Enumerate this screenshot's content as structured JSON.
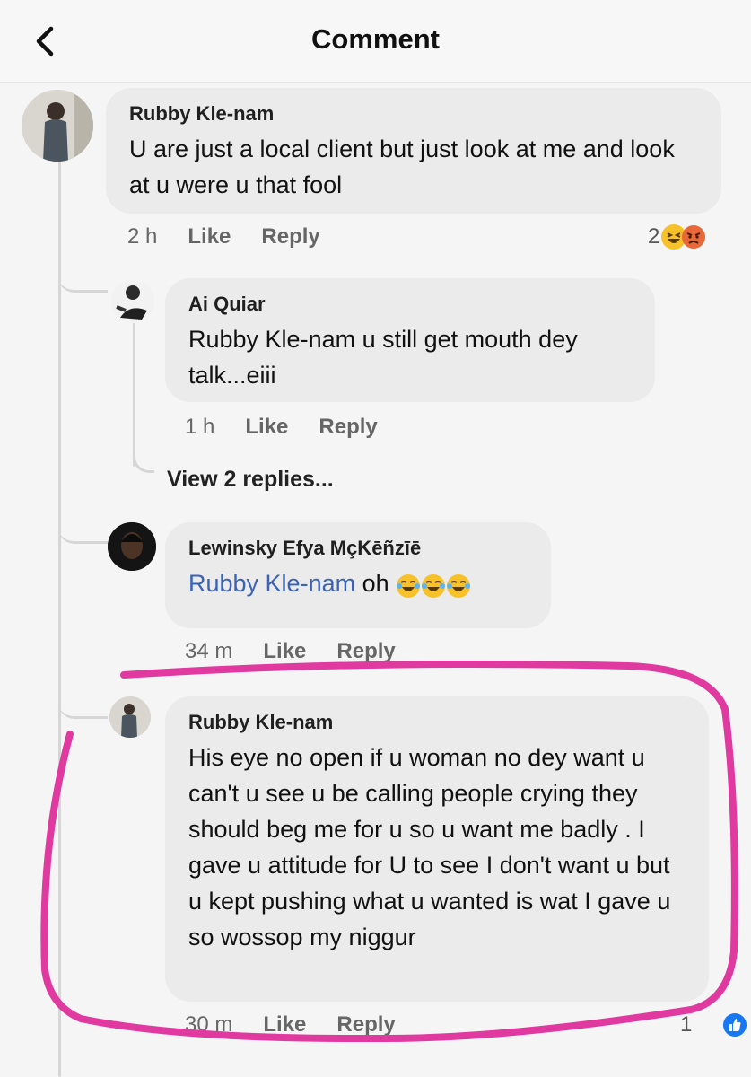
{
  "header": {
    "title": "Comment",
    "back_icon": "chevron-left-icon"
  },
  "comments": [
    {
      "author": "Rubby Kle-nam",
      "text": "U are just a local client but just look at me and look at u were u that fool",
      "time": "2 h",
      "like_label": "Like",
      "reply_label": "Reply",
      "reaction_count": "2",
      "reactions": [
        "haha-icon",
        "angry-icon"
      ]
    },
    {
      "author": "Ai Quiar",
      "text": "Rubby Kle-nam u still get mouth dey talk...eiii",
      "time": "1 h",
      "like_label": "Like",
      "reply_label": "Reply"
    },
    {
      "author": "Lewinsky Efya MçKēñzīē",
      "mention": "Rubby Kle-nam",
      "text": "oh",
      "emojis": [
        "laughing-tears-icon",
        "laughing-tears-icon",
        "laughing-tears-icon"
      ],
      "time": "34 m",
      "like_label": "Like",
      "reply_label": "Reply"
    },
    {
      "author": "Rubby Kle-nam",
      "text": "His eye no open if u woman no dey want u can't u see u be calling people crying they should beg me for u so u want me badly . I gave u attitude for U to see I don't want u but u kept pushing what u wanted is wat I gave u so wossop my niggur",
      "time": "30 m",
      "like_label": "Like",
      "reply_label": "Reply",
      "reaction_count": "1",
      "reactions": [
        "like-icon"
      ]
    }
  ],
  "view_replies_label": "View 2 replies...",
  "colors": {
    "highlight": "#e0399f",
    "mention": "#3a63b8",
    "like_blue": "#1877f2"
  }
}
